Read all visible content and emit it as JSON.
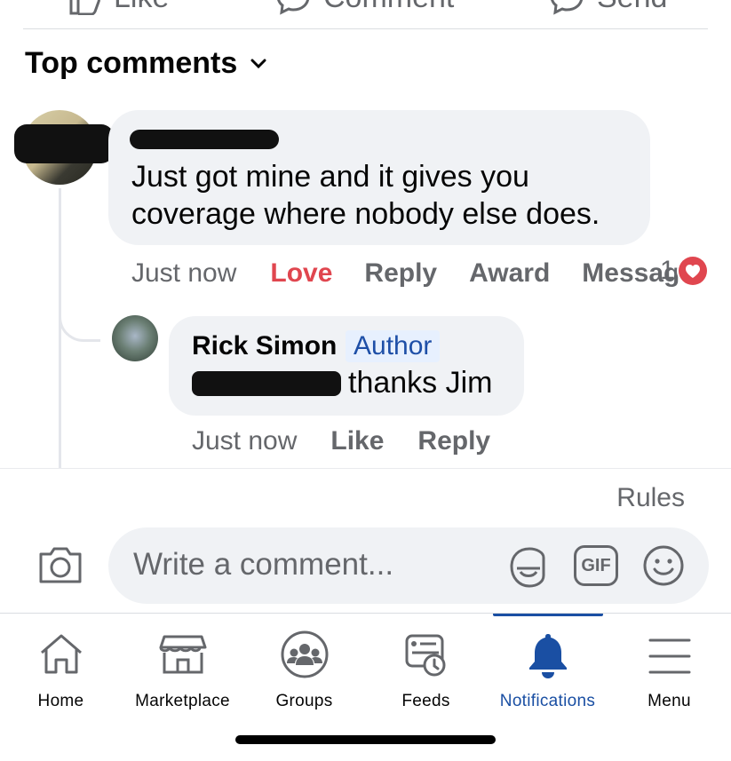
{
  "actions": {
    "like_label": "Like",
    "comment_label": "Comment",
    "send_label": "Send"
  },
  "sort": {
    "label": "Top comments"
  },
  "comments": [
    {
      "text": "Just got mine and it gives you coverage where nobody else does.",
      "time": "Just now",
      "love_label": "Love",
      "reply_label": "Reply",
      "award_label": "Award",
      "message_label": "Message",
      "reaction_count": "1"
    }
  ],
  "reply": {
    "author_name": "Rick Simon",
    "author_badge": "Author",
    "text": "thanks Jim",
    "time": "Just now",
    "like_label": "Like",
    "reply_label": "Reply"
  },
  "composer": {
    "rules_label": "Rules",
    "placeholder": "Write a comment...",
    "gif_label": "GIF"
  },
  "nav": {
    "items": [
      {
        "label": "Home"
      },
      {
        "label": "Marketplace"
      },
      {
        "label": "Groups"
      },
      {
        "label": "Feeds"
      },
      {
        "label": "Notifications"
      },
      {
        "label": "Menu"
      }
    ],
    "active": "Notifications"
  },
  "colors": {
    "accent": "#1a4fa3",
    "love": "#e0464f",
    "author_badge_bg": "#e7f0fe",
    "author_badge_text": "#1e4fa7"
  }
}
